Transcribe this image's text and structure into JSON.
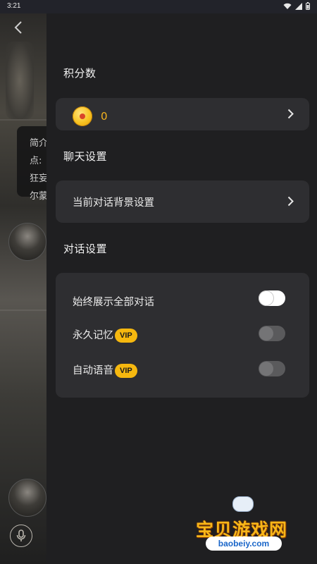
{
  "status_bar": {
    "time": "3:21"
  },
  "background": {
    "intro_lines": [
      "简介",
      "点:",
      "狂妄",
      "尔蒙"
    ]
  },
  "drawer": {
    "points": {
      "title": "积分数",
      "value": "0"
    },
    "chat_settings": {
      "title": "聊天设置",
      "background_label": "当前对话背景设置"
    },
    "dialog_settings": {
      "title": "对话设置",
      "items": [
        {
          "label": "始终展示全部对话",
          "vip": "",
          "state": "on"
        },
        {
          "label": "永久记忆",
          "vip": "VIP",
          "state": "off"
        },
        {
          "label": "自动语音",
          "vip": "VIP",
          "state": "off"
        }
      ]
    }
  },
  "watermark": {
    "brand": "宝贝游戏网",
    "url": "baobeiy.com"
  },
  "colors": {
    "accent": "#f6b80f",
    "drawer_bg": "#1f1f21",
    "card_bg": "#2e2e31"
  },
  "icons": [
    "back-icon",
    "wifi-icon",
    "signal-icon",
    "battery-icon",
    "coin-icon",
    "chevron-right-icon",
    "mic-icon"
  ]
}
